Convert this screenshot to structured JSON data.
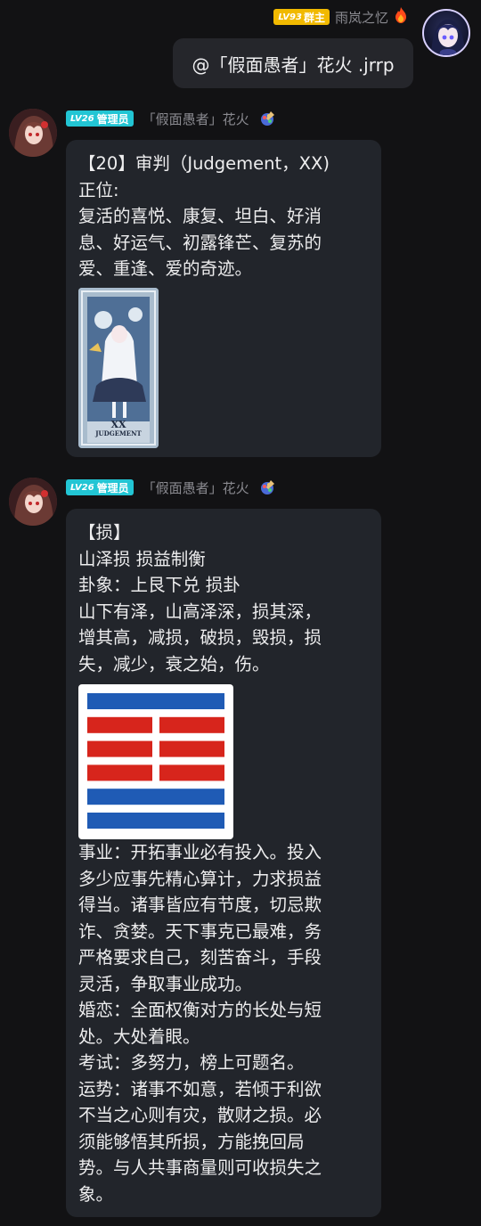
{
  "self_message": {
    "level_prefix": "LV93",
    "role": "群主",
    "nickname": "雨岚之忆",
    "badge_icon": "fire-icon",
    "text": "@「假面愚者」花火 .jrrp"
  },
  "messages": [
    {
      "level_prefix": "LV26",
      "role": "管理员",
      "nickname": "「假面愚者」花火",
      "lines": [
        "【20】审判（Judgement，XX)",
        "正位:",
        "复活的喜悦、康复、坦白、好消",
        "息、好运气、初露锋芒、复苏的",
        "爱、重逢、爱的奇迹。"
      ],
      "card_caption": "JUDGEMENT",
      "card_numeral": "XX"
    },
    {
      "level_prefix": "LV26",
      "role": "管理员",
      "nickname": "「假面愚者」花火",
      "lines_top": [
        "【损】",
        "山泽损 损益制衡",
        "卦象：上艮下兑 损卦",
        "山下有泽，山高泽深，损其深，",
        "增其高，减损，破损，毁损，损",
        "失，减少，衰之始，伤。"
      ],
      "hexagram_lines": [
        "solid",
        "broken",
        "broken",
        "broken",
        "solid",
        "solid"
      ],
      "colors": {
        "solid": "#1f5bb5",
        "broken": "#d7251c"
      },
      "lines_bottom": [
        "事业：开拓事业必有投入。投入",
        "多少应事先精心算计，力求损益",
        "得当。诸事皆应有节度，切忌欺",
        "诈、贪婪。天下事克已最难，务",
        "严格要求自己，刻苦奋斗，手段",
        "灵活，争取事业成功。",
        "婚恋：全面权衡对方的长处与短",
        "处。大处着眼。",
        "考试：多努力，榜上可题名。",
        "运势：诸事不如意，若倾于利欲",
        "不当之心则有灾，散财之损。必",
        "须能够悟其所损，方能挽回局",
        "势。与人共事商量则可收损失之",
        "象。"
      ]
    }
  ]
}
